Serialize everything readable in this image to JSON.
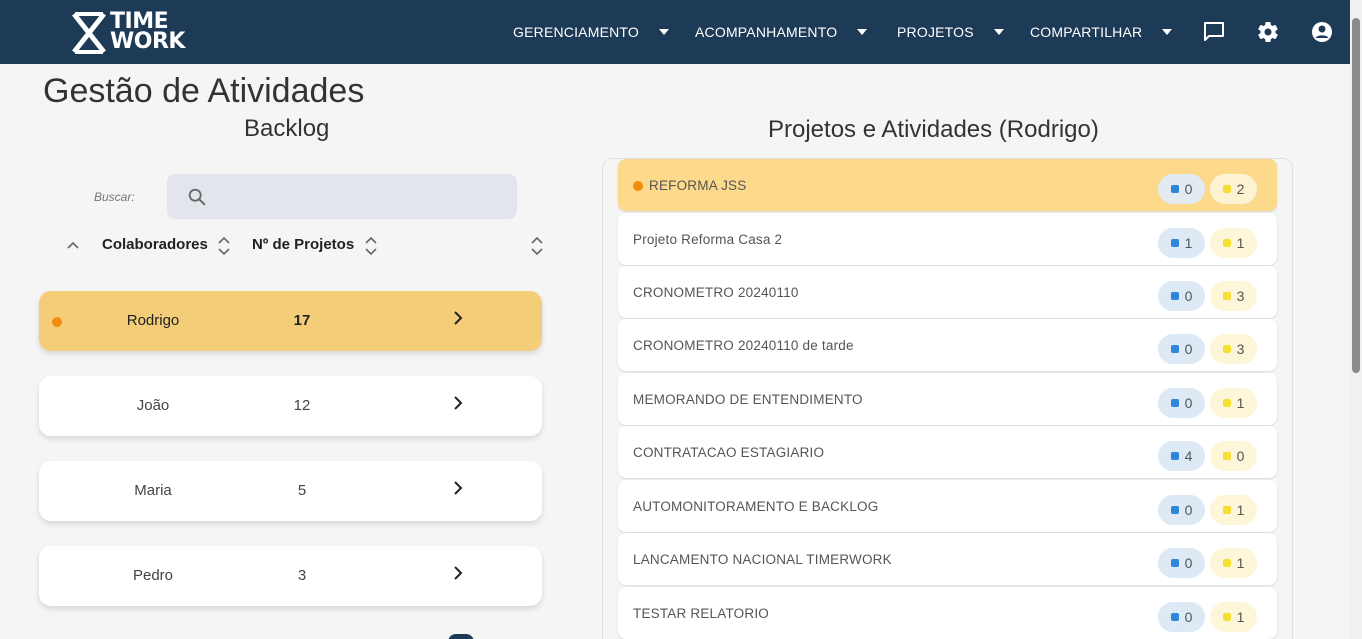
{
  "header": {
    "logo_line1": "TIME",
    "logo_line2": "WORK",
    "nav": [
      {
        "label": "GERENCIAMENTO"
      },
      {
        "label": "ACOMPANHAMENTO"
      },
      {
        "label": "PROJETOS"
      },
      {
        "label": "COMPARTILHAR"
      }
    ],
    "icons": [
      "chat-icon",
      "gear-icon",
      "account-icon"
    ],
    "bg_color": "#1d3a57"
  },
  "page": {
    "title": "Gestão de Atividades",
    "backlog_title": "Backlog",
    "right_title": "Projetos e Atividades (Rodrigo)"
  },
  "search": {
    "label": "Buscar:",
    "value": "",
    "placeholder": ""
  },
  "sort": {
    "col1": "Colaboradores",
    "col2": "Nº de Projetos"
  },
  "collaborators": [
    {
      "name": "Rodrigo",
      "projects": "17",
      "active": true
    },
    {
      "name": "João",
      "projects": "12",
      "active": false
    },
    {
      "name": "Maria",
      "projects": "5",
      "active": false
    },
    {
      "name": "Pedro",
      "projects": "3",
      "active": false
    }
  ],
  "projects": [
    {
      "name": "REFORMA JSS",
      "blue": "0",
      "yellow": "2",
      "active": true
    },
    {
      "name": "Projeto Reforma Casa 2",
      "blue": "1",
      "yellow": "1",
      "active": false
    },
    {
      "name": "CRONOMETRO 20240110",
      "blue": "0",
      "yellow": "3",
      "active": false
    },
    {
      "name": "CRONOMETRO 20240110 de tarde",
      "blue": "0",
      "yellow": "3",
      "active": false
    },
    {
      "name": "MEMORANDO DE ENTENDIMENTO",
      "blue": "0",
      "yellow": "1",
      "active": false
    },
    {
      "name": "CONTRATACAO ESTAGIARIO",
      "blue": "4",
      "yellow": "0",
      "active": false
    },
    {
      "name": "AUTOMONITORAMENTO E BACKLOG",
      "blue": "0",
      "yellow": "1",
      "active": false
    },
    {
      "name": "LANCAMENTO NACIONAL TIMERWORK",
      "blue": "0",
      "yellow": "1",
      "active": false
    },
    {
      "name": "TESTAR RELATORIO",
      "blue": "0",
      "yellow": "1",
      "active": false
    }
  ],
  "colors": {
    "accent_orange": "#f28c0c",
    "active_card": "#f3cd78",
    "active_project": "#fdd98c",
    "badge_blue": "#2e86d9",
    "badge_yellow": "#f5df37"
  }
}
